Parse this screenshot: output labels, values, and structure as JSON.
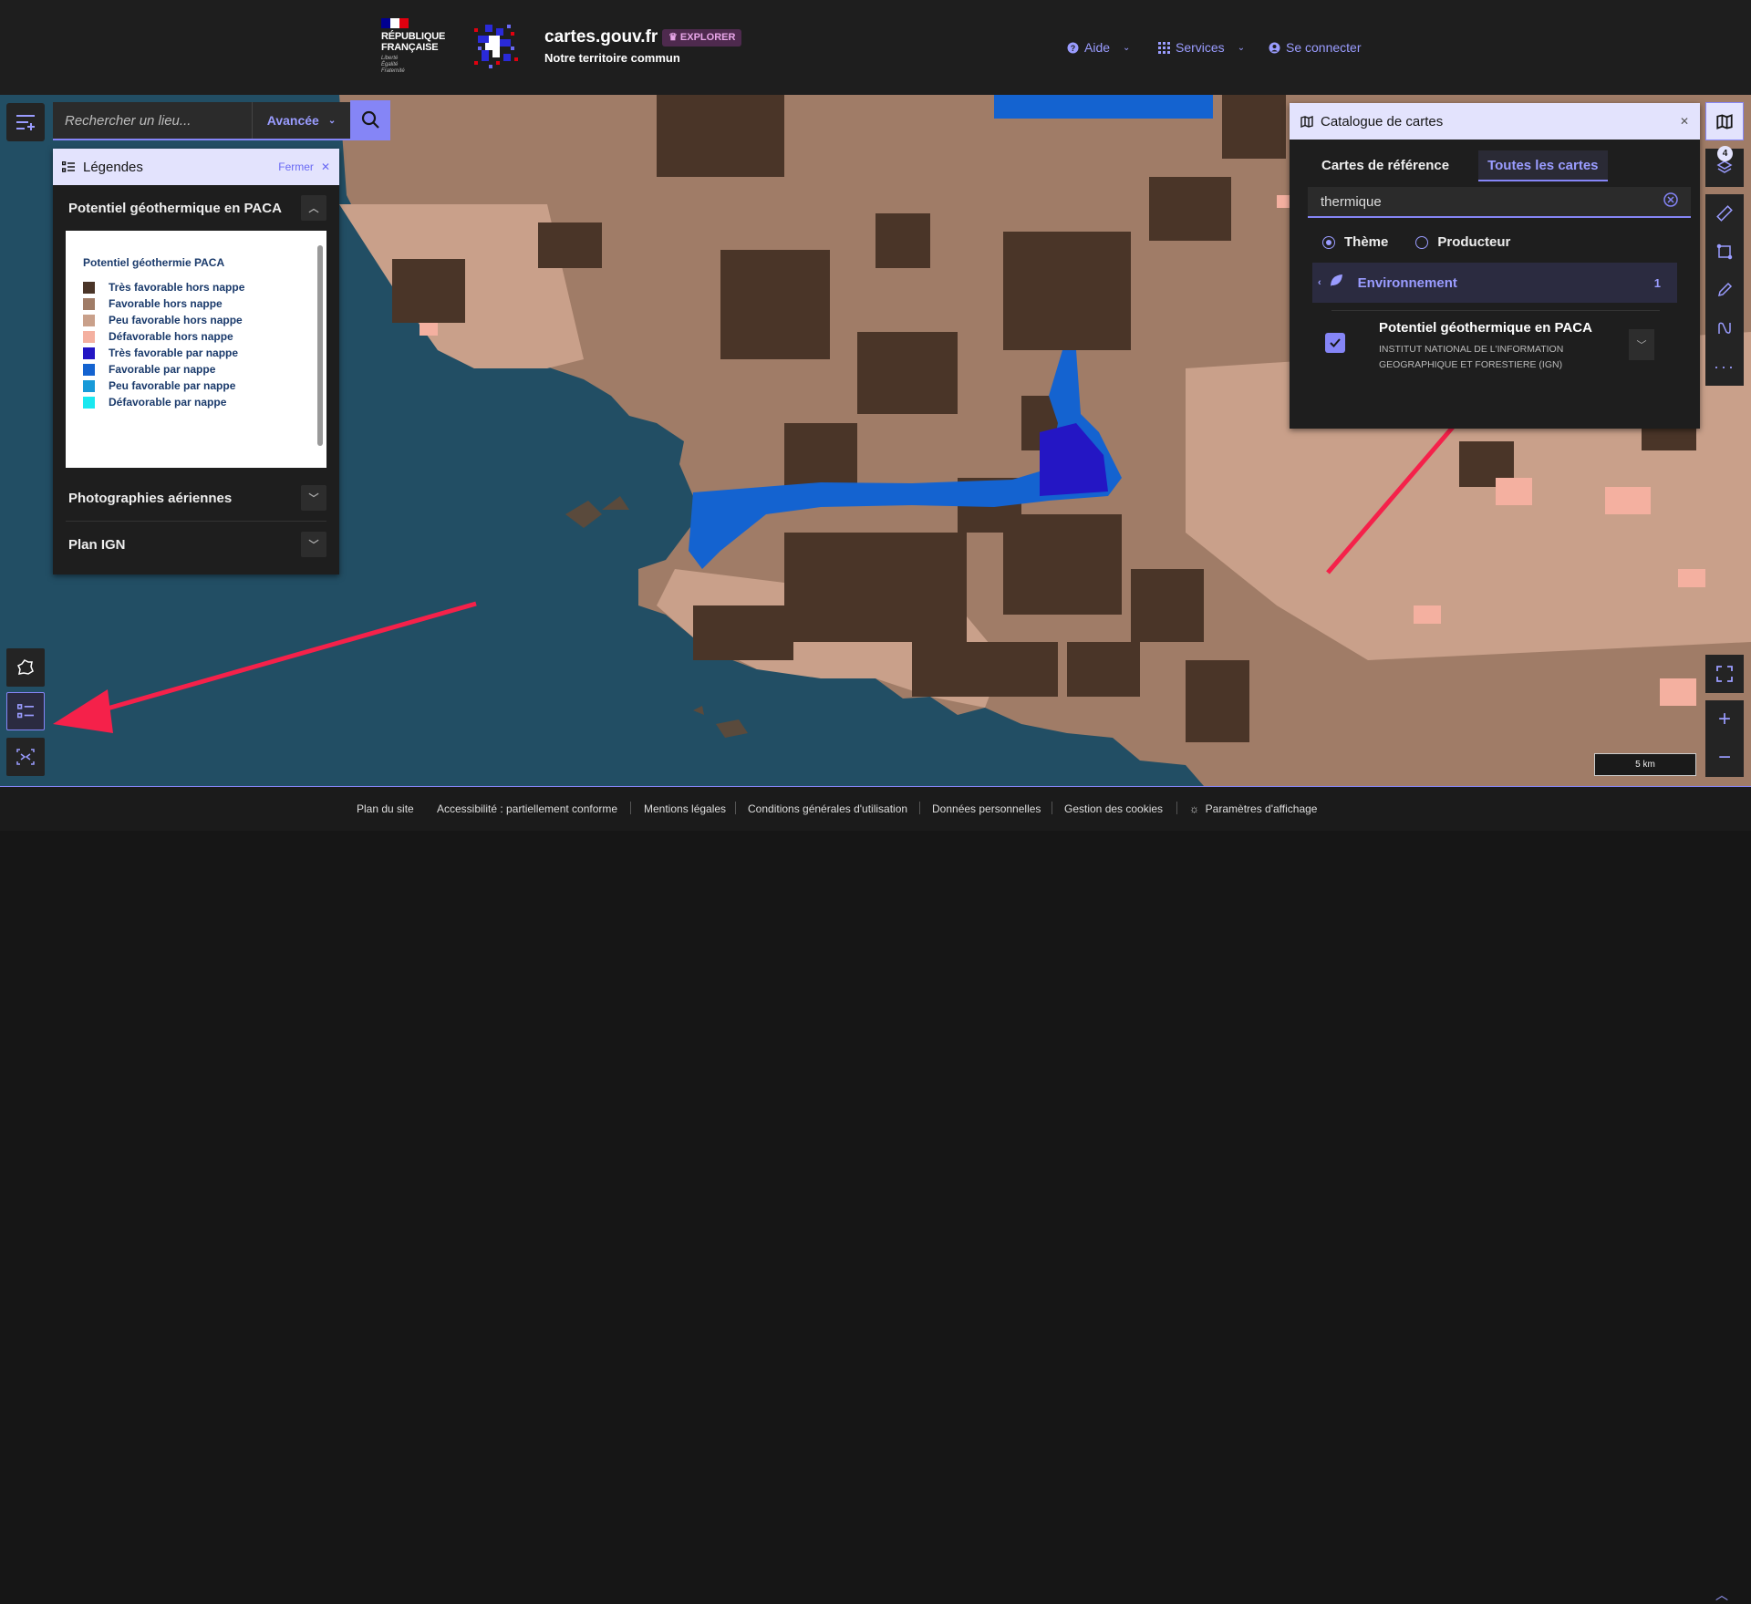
{
  "header": {
    "gov_name_line1": "RÉPUBLIQUE",
    "gov_name_line2": "FRANÇAISE",
    "gov_motto": [
      "Liberté",
      "Égalité",
      "Fraternité"
    ],
    "site_name": "cartes.gouv.fr",
    "badge": "EXPLORER",
    "tagline": "Notre territoire commun",
    "nav": {
      "help": "Aide",
      "services": "Services",
      "login": "Se connecter"
    }
  },
  "search": {
    "placeholder": "Rechercher un lieu...",
    "mode": "Avancée"
  },
  "legend_panel": {
    "title": "Légendes",
    "close_label": "Fermer",
    "layers": [
      {
        "title": "Potentiel géothermique en PACA",
        "expanded": true
      },
      {
        "title": "Photographies aériennes",
        "expanded": false
      },
      {
        "title": "Plan IGN",
        "expanded": false
      }
    ],
    "legend_title": "Potentiel géothermie PACA",
    "legend_items": [
      {
        "label": "Très favorable hors nappe",
        "color": "#4a3528"
      },
      {
        "label": "Favorable hors nappe",
        "color": "#a07c67"
      },
      {
        "label": "Peu favorable hors nappe",
        "color": "#c9a08a"
      },
      {
        "label": "Défavorable hors nappe",
        "color": "#f4b0a0"
      },
      {
        "label": "Très favorable par nappe",
        "color": "#2416c4"
      },
      {
        "label": "Favorable par nappe",
        "color": "#1463d0"
      },
      {
        "label": "Peu favorable par nappe",
        "color": "#189ad8"
      },
      {
        "label": "Défavorable par nappe",
        "color": "#1ae8f0"
      }
    ]
  },
  "catalog_panel": {
    "title": "Catalogue de cartes",
    "tabs": [
      "Cartes de référence",
      "Toutes les cartes"
    ],
    "active_tab": "Toutes les cartes",
    "search_value": "thermique",
    "filter_options": [
      "Thème",
      "Producteur"
    ],
    "selected_filter": "Thème",
    "category": {
      "label": "Environnement",
      "count": "1"
    },
    "result": {
      "title": "Potentiel géothermique en PACA",
      "producer": "INSTITUT NATIONAL DE L'INFORMATION GEOGRAPHIQUE ET FORESTIERE (IGN)",
      "checked": true
    }
  },
  "toolbar": {
    "layers_count": "4"
  },
  "scale": {
    "label": "5 km"
  },
  "footer": {
    "links": [
      "Plan du site",
      "Accessibilité : partiellement conforme",
      "Mentions légales",
      "Conditions générales d'utilisation",
      "Données personnelles",
      "Gestion des cookies",
      "Paramètres d'affichage"
    ]
  },
  "colors": {
    "accent": "#8585f6",
    "accent_light": "#e3e3fd",
    "annotation_arrow": "#f5214a",
    "sea": "#1f4a60"
  }
}
